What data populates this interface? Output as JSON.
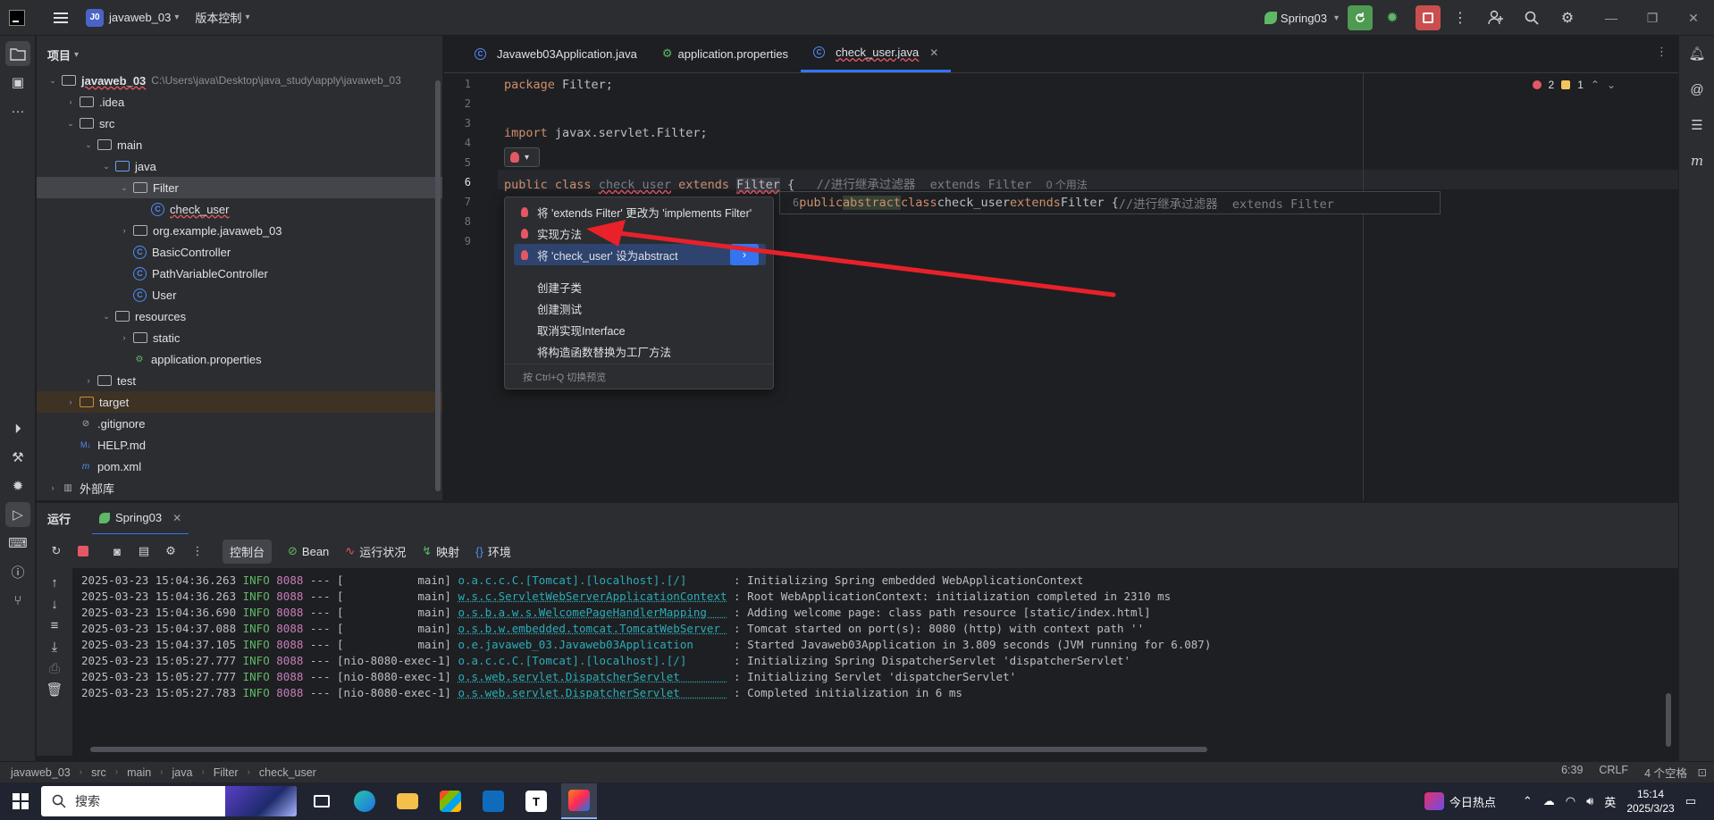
{
  "titlebar": {
    "project_badge": "J0",
    "project_name": "javaweb_03",
    "vcs_label": "版本控制",
    "run_config": "Spring03"
  },
  "project_panel": {
    "title": "项目",
    "tree": [
      {
        "label": "javaweb_03",
        "path": "C:\\Users\\java\\Desktop\\java_study\\apply\\javaweb_03",
        "level": 0,
        "kind": "folder"
      },
      {
        "label": ".idea",
        "level": 1,
        "kind": "folder"
      },
      {
        "label": "src",
        "level": 1,
        "kind": "folder"
      },
      {
        "label": "main",
        "level": 2,
        "kind": "folder"
      },
      {
        "label": "java",
        "level": 3,
        "kind": "folder-blue"
      },
      {
        "label": "Filter",
        "level": 4,
        "kind": "folder"
      },
      {
        "label": "check_user",
        "level": 5,
        "kind": "class"
      },
      {
        "label": "org.example.javaweb_03",
        "level": 4,
        "kind": "folder"
      },
      {
        "label": "BasicController",
        "level": 4,
        "kind": "class"
      },
      {
        "label": "PathVariableController",
        "level": 4,
        "kind": "class"
      },
      {
        "label": "User",
        "level": 4,
        "kind": "class"
      },
      {
        "label": "resources",
        "level": 3,
        "kind": "folder"
      },
      {
        "label": "static",
        "level": 4,
        "kind": "folder"
      },
      {
        "label": "application.properties",
        "level": 4,
        "kind": "props"
      },
      {
        "label": "test",
        "level": 2,
        "kind": "folder"
      },
      {
        "label": "target",
        "level": 1,
        "kind": "folder-orange"
      },
      {
        "label": ".gitignore",
        "level": 1,
        "kind": "ignore"
      },
      {
        "label": "HELP.md",
        "level": 1,
        "kind": "md"
      },
      {
        "label": "pom.xml",
        "level": 1,
        "kind": "maven"
      },
      {
        "label": "外部库",
        "level": 0,
        "kind": "lib"
      }
    ]
  },
  "editor": {
    "tabs": [
      {
        "label": "Javaweb03Application.java"
      },
      {
        "label": "application.properties"
      },
      {
        "label": "check_user.java"
      }
    ],
    "error_count": "2",
    "warning_count": "1",
    "line_numbers": [
      "1",
      "2",
      "3",
      "4",
      "5",
      "6",
      "7",
      "8",
      "9"
    ],
    "line1": {
      "kw": "package",
      "rest": " Filter;"
    },
    "line4": {
      "kw": "import",
      "rest": " javax.servlet.Filter;"
    },
    "line6": {
      "kw1": "public",
      "kw2": "class",
      "cls": "check_user",
      "kw3": "extends",
      "sup": "Filter",
      "brace": " {",
      "comment": "//进行继承过滤器  extends Filter",
      "hint": "0 个用法"
    },
    "preview": {
      "num": "6",
      "kw1": "public",
      "kw2": "abstract",
      "kw3": "class",
      "cls": "check_user",
      "kw4": "extends",
      "sup": "Filter",
      "brace": " {",
      "comment": "//进行继承过滤器  extends Filter"
    }
  },
  "popup": {
    "items": [
      {
        "label": "将 'extends Filter' 更改为 'implements Filter'",
        "icon": "error-bulb"
      },
      {
        "label": "实现方法",
        "icon": "error-bulb"
      },
      {
        "label": "将 'check_user' 设为abstract",
        "icon": "error-bulb"
      },
      {
        "label": "创建子类",
        "icon": "none"
      },
      {
        "label": "创建测试",
        "icon": "none"
      },
      {
        "label": "取消实现Interface",
        "icon": "none"
      },
      {
        "label": "将构造函数替换为工厂方法",
        "icon": "none"
      }
    ],
    "footer": "按 Ctrl+Q 切换预览"
  },
  "run_panel": {
    "title": "运行",
    "tab": "Spring03",
    "toolbar_tabs": [
      "控制台",
      "Bean",
      "运行状况",
      "映射",
      "环境"
    ],
    "logs": [
      {
        "ts": "2025-03-23 15:04:36.263",
        "lv": "INFO",
        "pid": "8088",
        "sep": "---",
        "thread": "[           main]",
        "logger": "o.a.c.c.C.[Tomcat].[localhost].[/]      ",
        "msg": ": Initializing Spring embedded WebApplicationContext"
      },
      {
        "ts": "2025-03-23 15:04:36.263",
        "lv": "INFO",
        "pid": "8088",
        "sep": "---",
        "thread": "[           main]",
        "logger": "w.s.c.ServletWebServerApplicationContext",
        "msg": ": Root WebApplicationContext: initialization completed in 2310 ms"
      },
      {
        "ts": "2025-03-23 15:04:36.690",
        "lv": "INFO",
        "pid": "8088",
        "sep": "---",
        "thread": "[           main]",
        "logger": "o.s.b.a.w.s.WelcomePageHandlerMapping   ",
        "msg": ": Adding welcome page: class path resource [static/index.html]"
      },
      {
        "ts": "2025-03-23 15:04:37.088",
        "lv": "INFO",
        "pid": "8088",
        "sep": "---",
        "thread": "[           main]",
        "logger": "o.s.b.w.embedded.tomcat.TomcatWebServer ",
        "msg": ": Tomcat started on port(s): 8080 (http) with context path ''"
      },
      {
        "ts": "2025-03-23 15:04:37.105",
        "lv": "INFO",
        "pid": "8088",
        "sep": "---",
        "thread": "[           main]",
        "logger": "o.e.javaweb_03.Javaweb03Application     ",
        "msg": ": Started Javaweb03Application in 3.809 seconds (JVM running for 6.087)"
      },
      {
        "ts": "2025-03-23 15:05:27.777",
        "lv": "INFO",
        "pid": "8088",
        "sep": "---",
        "thread": "[nio-8080-exec-1]",
        "logger": "o.a.c.c.C.[Tomcat].[localhost].[/]      ",
        "msg": ": Initializing Spring DispatcherServlet 'dispatcherServlet'"
      },
      {
        "ts": "2025-03-23 15:05:27.777",
        "lv": "INFO",
        "pid": "8088",
        "sep": "---",
        "thread": "[nio-8080-exec-1]",
        "logger": "o.s.web.servlet.DispatcherServlet       ",
        "msg": ": Initializing Servlet 'dispatcherServlet'"
      },
      {
        "ts": "2025-03-23 15:05:27.783",
        "lv": "INFO",
        "pid": "8088",
        "sep": "---",
        "thread": "[nio-8080-exec-1]",
        "logger": "o.s.web.servlet.DispatcherServlet       ",
        "msg": ": Completed initialization in 6 ms"
      }
    ]
  },
  "statusbar": {
    "crumbs": [
      "javaweb_03",
      "src",
      "main",
      "java",
      "Filter",
      "check_user"
    ],
    "position": "6:39",
    "line_sep": "CRLF",
    "indent": "4 个空格"
  },
  "taskbar": {
    "search": "搜索",
    "news": "今日热点",
    "ime": "英",
    "time": "15:14",
    "date": "2025/3/23"
  },
  "colors": {
    "accent": "#3574f0",
    "error": "#e55765",
    "keyword": "#cf8e6d",
    "log_info": "#5fb865",
    "arrow": "#e8212a"
  }
}
